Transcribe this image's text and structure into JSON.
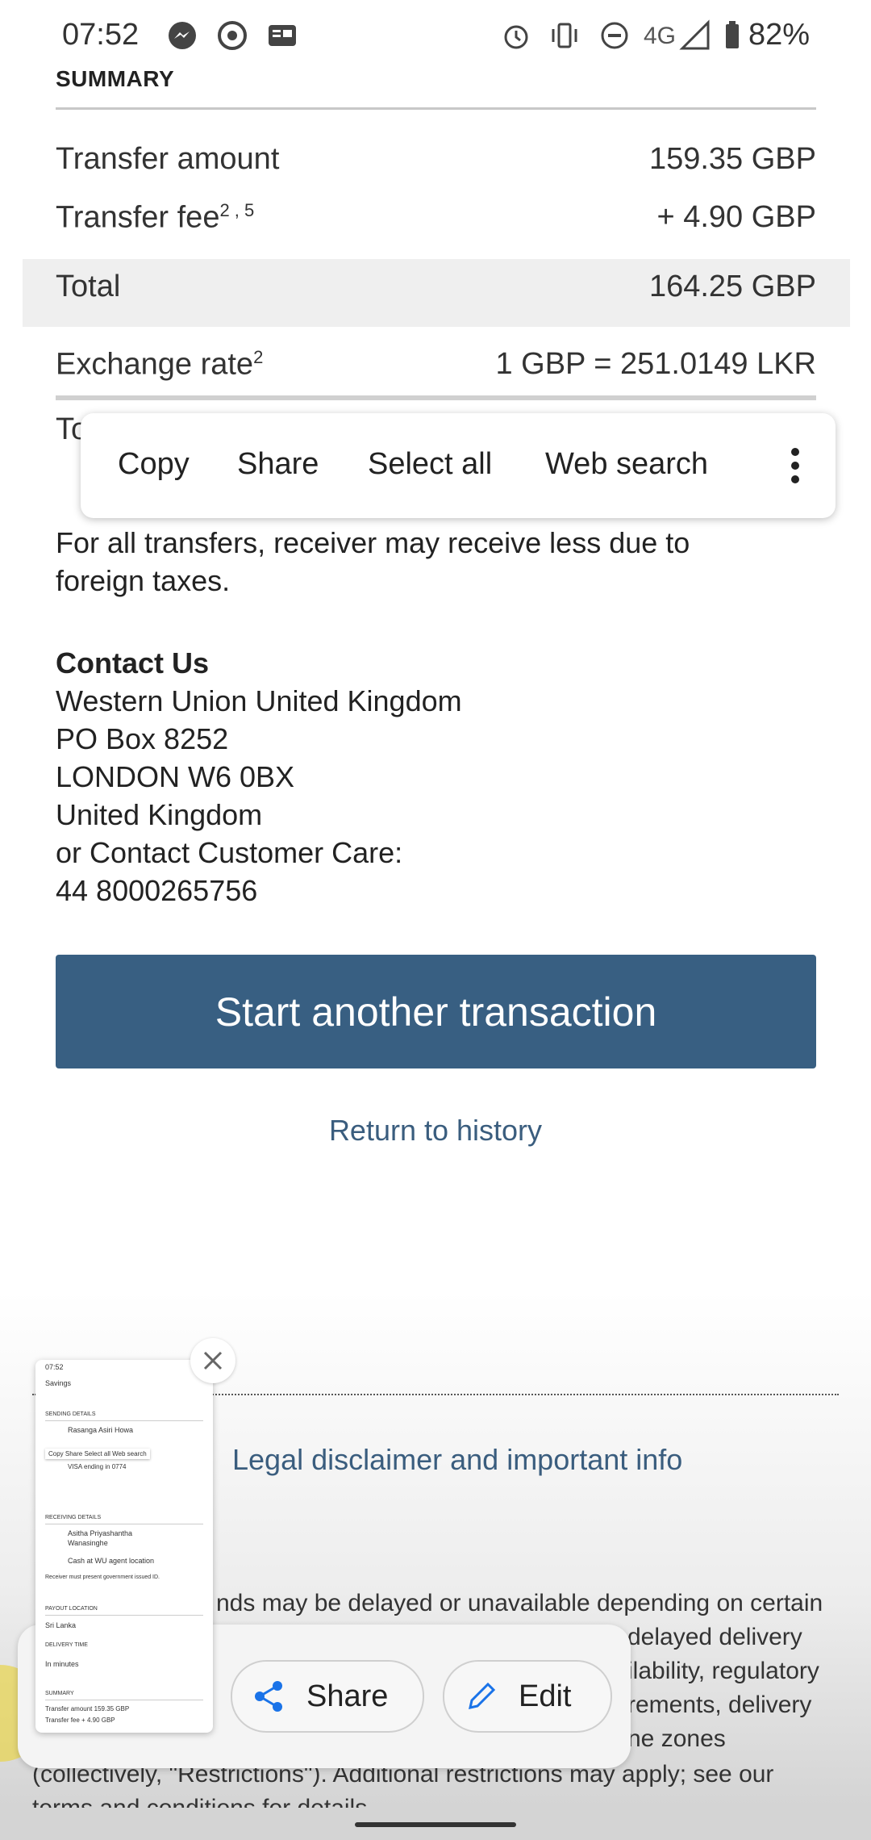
{
  "status_bar": {
    "time": "07:52",
    "network": "4G",
    "battery": "82%"
  },
  "summary": {
    "title": "SUMMARY",
    "transfer_amount_label": "Transfer amount",
    "transfer_amount_value": "159.35 GBP",
    "transfer_fee_label": "Transfer fee",
    "transfer_fee_sup": "2 , 5",
    "transfer_fee_value": "+ 4.90 GBP",
    "total_label": "Total",
    "total_value": "164.25 GBP",
    "exchange_rate_label": "Exchange rate",
    "exchange_rate_sup": "2",
    "exchange_rate_value": "1 GBP = 251.0149  LKR",
    "partial_row_label": "To"
  },
  "context_menu": {
    "items": [
      "Copy",
      "Share",
      "Select all",
      "Web search"
    ]
  },
  "notice": {
    "line1": "For all transfers, receiver may receive less due to",
    "line2": "foreign taxes."
  },
  "contact": {
    "title": "Contact Us",
    "lines": [
      "Western Union United Kingdom",
      "PO Box 8252",
      "LONDON W6 0BX",
      "United Kingdom",
      "or Contact Customer Care:",
      "44 8000265756"
    ]
  },
  "actions": {
    "start_button": "Start another transaction",
    "return_link": "Return to history"
  },
  "legal": {
    "link": "Legal disclaimer and important info",
    "fine_lines": [
      "nds may be delayed or unavailable depending on certain",
      "delayed delivery",
      "ilability, regulatory",
      "rements, delivery",
      "ne zones",
      "(collectively, \"Restrictions\"). Additional restrictions may apply; see our",
      "terms and conditions for details"
    ]
  },
  "screenshot_toolbar": {
    "share_label": "Share",
    "edit_label": "Edit"
  },
  "thumbnail": {
    "lines": {
      "time": "07:52",
      "savings": "Savings",
      "sending": "SENDING DETAILS",
      "sender": "Rasanga Asiri Howa",
      "menu": "Copy   Share   Select all   Web search",
      "card": "VISA ending in 0774",
      "receiving": "RECEIVING DETAILS",
      "receiver1": "Asitha Priyashantha",
      "receiver2": "Wanasinghe",
      "cash": "Cash at WU agent location",
      "note": "Receiver must present government issued ID.",
      "payout": "PAYOUT LOCATION",
      "country": "Sri Lanka",
      "delivery": "DELIVERY TIME",
      "minutes": "In minutes",
      "summary": "SUMMARY",
      "amount": "Transfer amount     159.35 GBP",
      "fee": "Transfer fee      + 4.90 GBP"
    }
  }
}
